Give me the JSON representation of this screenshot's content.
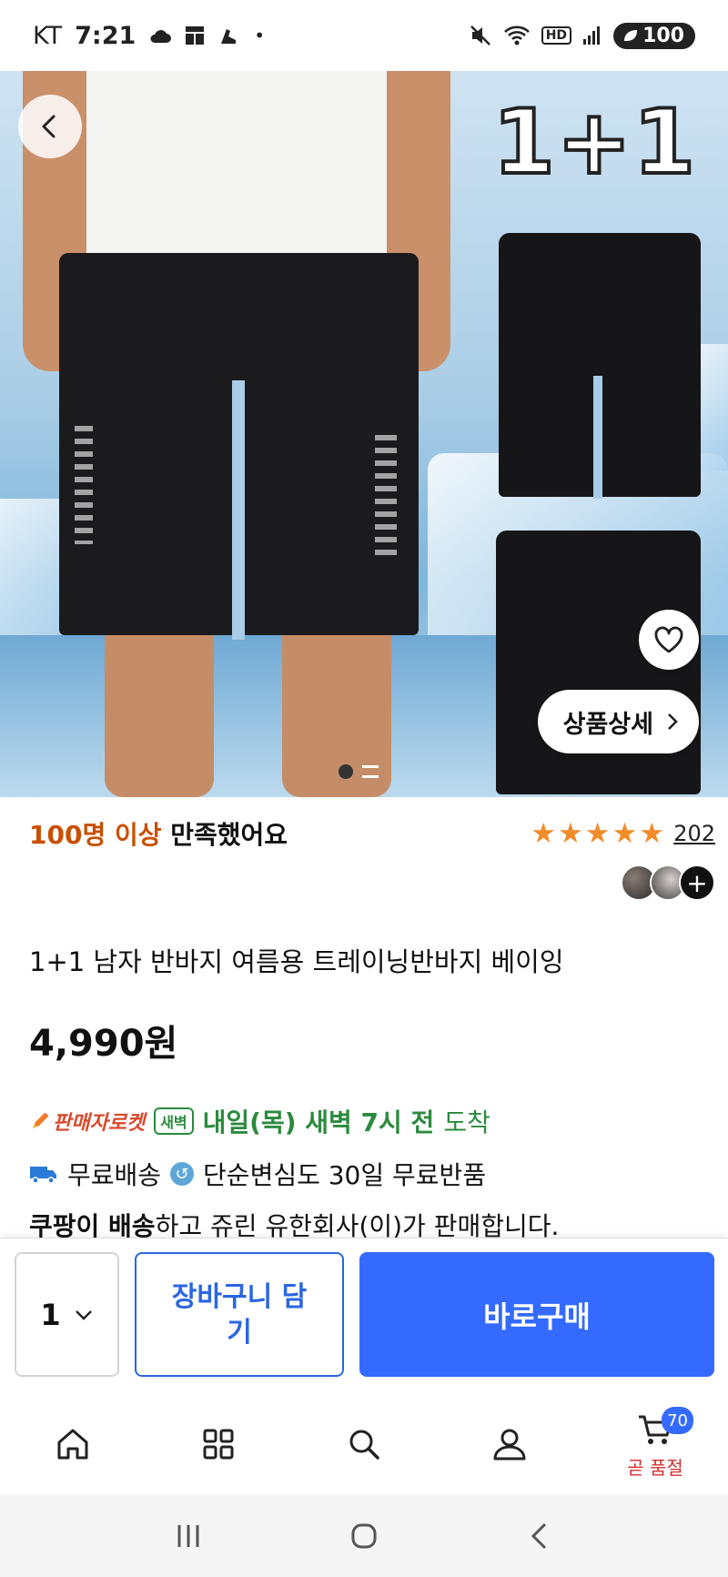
{
  "status_bar": {
    "carrier": "KT",
    "time": "7:21",
    "hd": "HD",
    "battery": "100"
  },
  "hero": {
    "promo_text": "1+1",
    "detail_button": "상품상세",
    "icons": [
      "back-arrow-icon",
      "heart-icon",
      "chevron-right-icon"
    ],
    "bg_colors": [
      "#cfe3f2",
      "#7fb6db"
    ]
  },
  "product": {
    "satisfaction_highlight": "100명 이상",
    "satisfaction_rest": "만족했어요",
    "rating_stars": 5,
    "review_count": "202",
    "title": "1+1 남자 반바지 여름용 트레이닝반바지 베이잉",
    "price": "4,990원",
    "rocket_label": "판매자로켓",
    "dawn_badge": "새벽",
    "arrival_bold": "내일(목) 새벽 7시 전",
    "arrival_rest": "도착",
    "free_shipping": "무료배송",
    "return_policy": "단순변심도 30일 무료반품",
    "seller_bold": "쿠팡이 배송",
    "seller_rest": "하고 쥬린 유한회사(이)가 판매합니다."
  },
  "buy_bar": {
    "quantity": "1",
    "cart_button": "장바구니 담기",
    "buy_button": "바로구매",
    "accent_color": "#346aff"
  },
  "tab_bar": {
    "icons": [
      "home-icon",
      "category-icon",
      "search-icon",
      "profile-icon",
      "cart-icon"
    ],
    "cart_badge": "70",
    "cart_soon": "곧 품절"
  },
  "nav_bar": {
    "icons": [
      "recent-apps-icon",
      "home-nav-icon",
      "back-nav-icon"
    ]
  }
}
